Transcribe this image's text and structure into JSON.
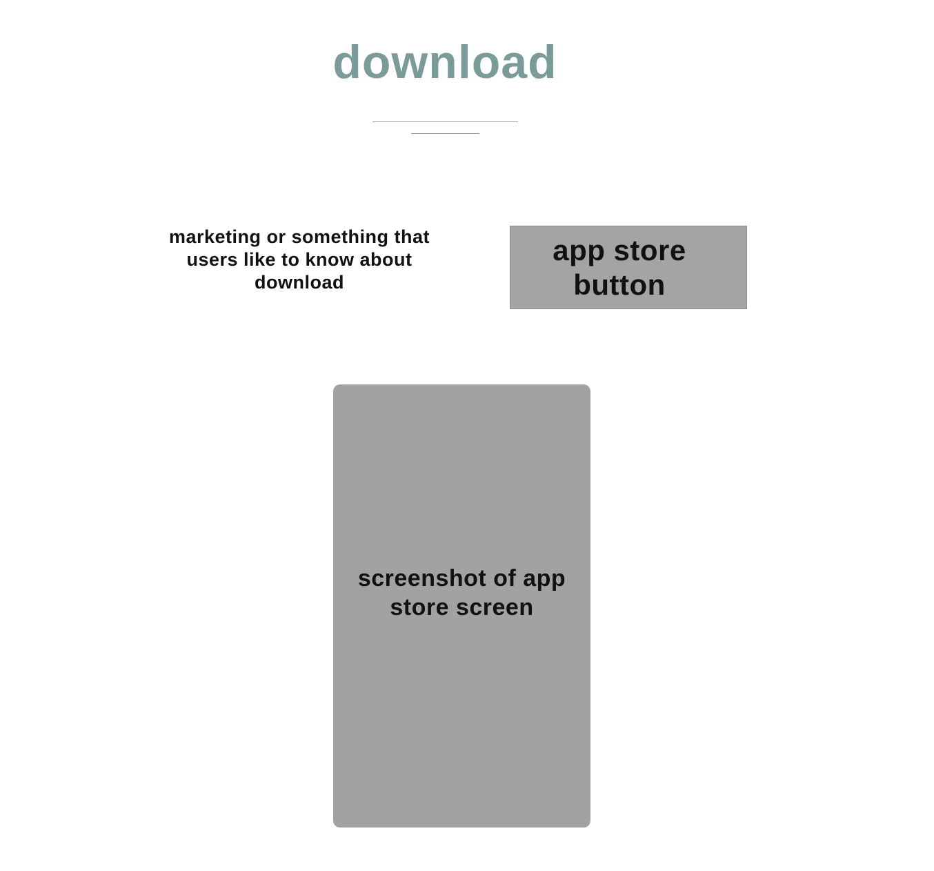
{
  "header": {
    "title": "download",
    "title_color": "#7a9b98"
  },
  "marketing": {
    "text": "marketing or something that users like to know about download"
  },
  "app_store_button": {
    "label": "app store button",
    "background_color": "#a4a4a4"
  },
  "screenshot_placeholder": {
    "label": "screenshot of app store screen",
    "background_color": "#a2a2a2"
  }
}
